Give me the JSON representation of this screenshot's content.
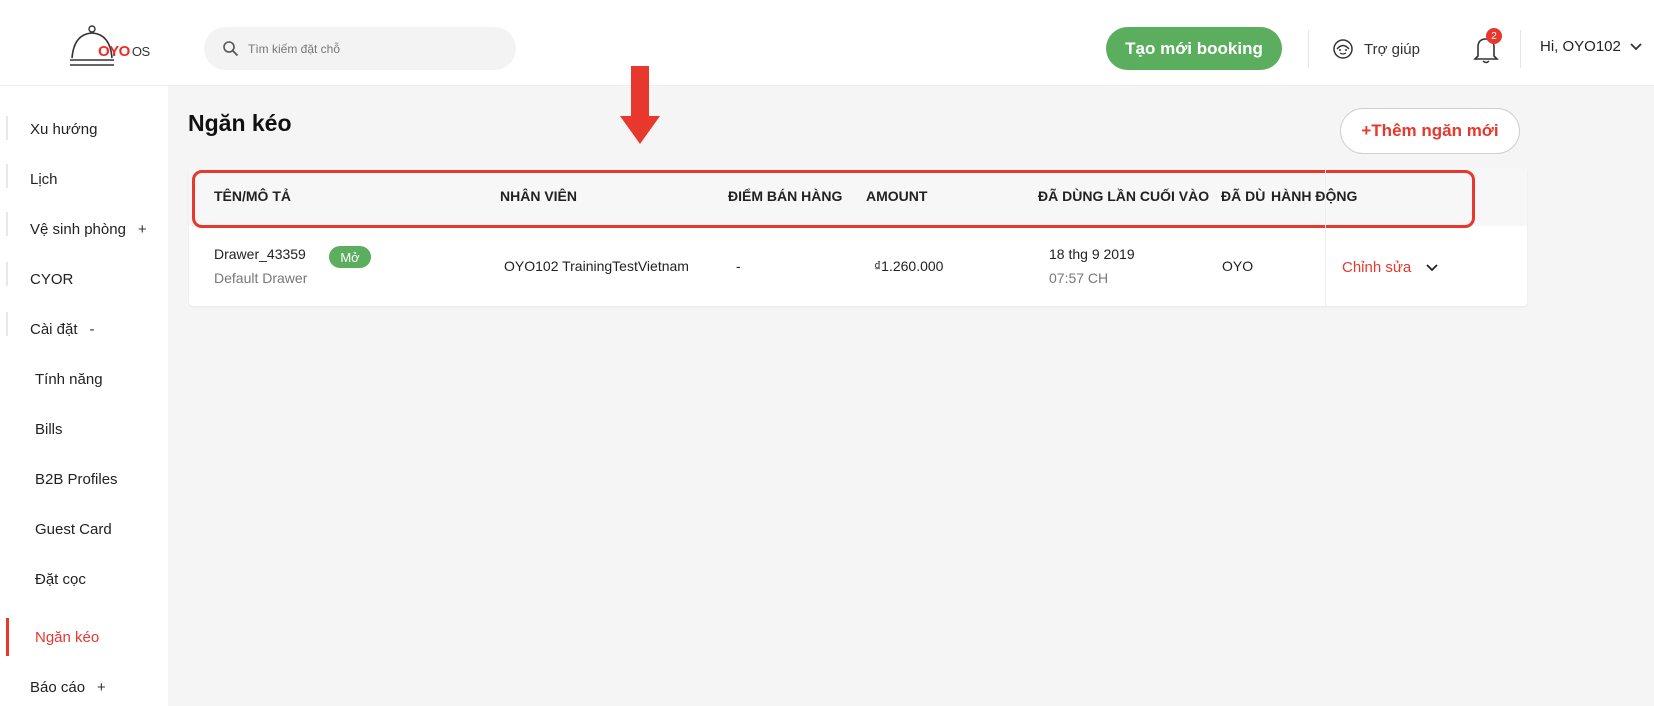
{
  "header": {
    "logo_text": "OYO",
    "logo_os": "OS",
    "search_placeholder": "Tìm kiếm đặt chỗ",
    "create_booking": "Tạo mới booking",
    "help": "Trợ giúp",
    "notification_count": "2",
    "user_greeting": "Hi, OYO102"
  },
  "sidebar": {
    "items": [
      {
        "label": "Xu hướng"
      },
      {
        "label": "Lịch"
      },
      {
        "label": "Vệ sinh phòng",
        "toggle": "+"
      },
      {
        "label": "CYOR"
      },
      {
        "label": "Cài đặt",
        "toggle": "-"
      },
      {
        "label": "Tính năng"
      },
      {
        "label": "Bills"
      },
      {
        "label": "B2B Profiles"
      },
      {
        "label": "Guest Card"
      },
      {
        "label": "Đặt cọc"
      },
      {
        "label": "Ngăn kéo"
      },
      {
        "label": "Báo cáo",
        "toggle": "+"
      }
    ]
  },
  "page": {
    "title": "Ngăn kéo",
    "add_button": "+Thêm ngăn mới"
  },
  "table": {
    "headers": [
      "TÊN/MÔ TẢ",
      "NHÂN VIÊN",
      "ĐIỂM BÁN HÀNG",
      "AMOUNT",
      "ĐÃ DÙNG LẦN CUỐI VÀO",
      "ĐÃ DÙ",
      "HÀNH ĐỘNG"
    ],
    "rows": [
      {
        "name": "Drawer_43359",
        "status": "Mở",
        "description": "Default Drawer",
        "staff": "OYO102 TrainingTestVietnam",
        "pos": "-",
        "amount": "₫1.260.000",
        "last_used_date": "18 thg 9 2019",
        "last_used_time": "07:57 CH",
        "used_by": "OYO",
        "action": "Chỉnh sửa"
      }
    ]
  },
  "colors": {
    "accent": "#e8372c",
    "green": "#5cae5f"
  }
}
